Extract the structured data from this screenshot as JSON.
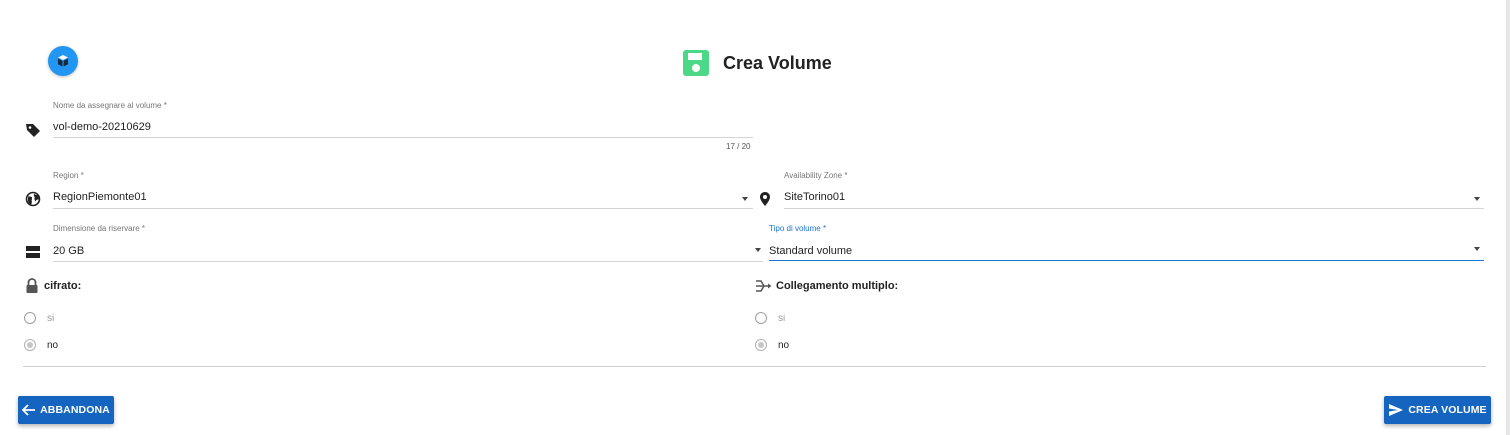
{
  "page": {
    "title": "Crea Volume"
  },
  "colors": {
    "primary": "#1565c0",
    "accent_blue": "#2196f3",
    "title_icon": "#4cd987",
    "active_field": "#1976d2"
  },
  "icons": {
    "avatar": "cube-icon",
    "title": "floppy-disk-icon",
    "name": "tag-icon",
    "region": "globe-icon",
    "zone": "map-pin-icon",
    "size": "storage-icon",
    "encrypted": "lock-icon",
    "multiattach": "multi-link-icon"
  },
  "form": {
    "name": {
      "label": "Nome da assegnare al volume *",
      "value": "vol-demo-20210629",
      "counter": "17 / 20"
    },
    "region": {
      "label": "Region *",
      "value": "RegionPiemonte01"
    },
    "zone": {
      "label": "Availability Zone *",
      "value": "SiteTorino01"
    },
    "size": {
      "label": "Dimensione da riservare *",
      "value": "20 GB"
    },
    "type": {
      "label": "Tipo di volume *",
      "value": "Standard volume"
    },
    "encrypted": {
      "title": "cifrato:",
      "options": [
        "si",
        "no"
      ],
      "selected": "no"
    },
    "multiattach": {
      "title": "Collegamento multiplo:",
      "options": [
        "si",
        "no"
      ],
      "selected": "no"
    }
  },
  "actions": {
    "cancel": "ABBANDONA",
    "submit": "CREA VOLUME"
  }
}
